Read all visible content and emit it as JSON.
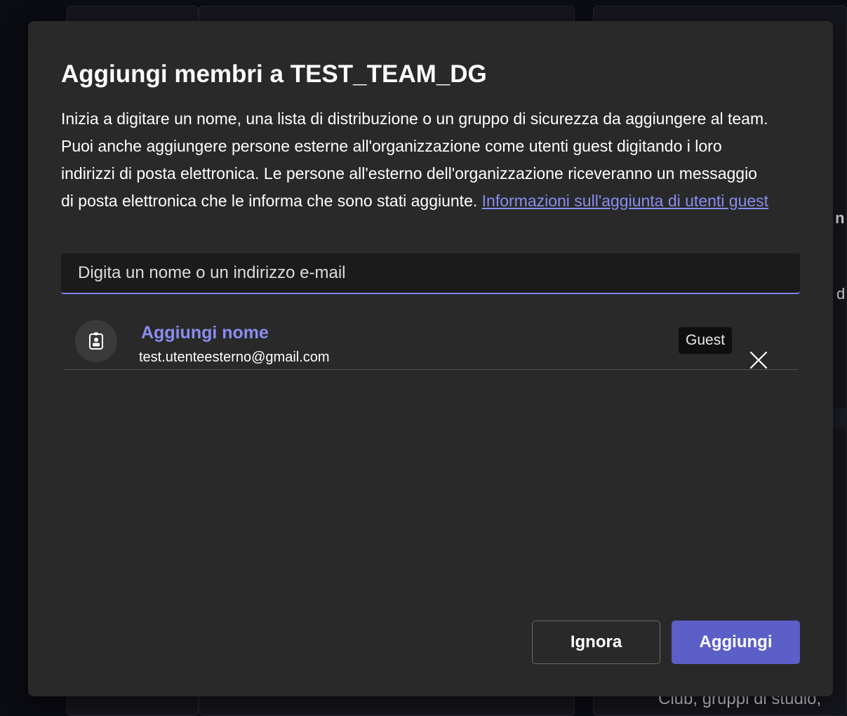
{
  "background": {
    "fragment_1": "n",
    "fragment_2": "d",
    "fragment_3": "Club, gruppi di studio,"
  },
  "dialog": {
    "title": "Aggiungi membri a TEST_TEAM_DG",
    "description": "Inizia a digitare un nome, una lista di distribuzione o un gruppo di sicurezza da aggiungere al team. Puoi anche aggiungere persone esterne all'organizzazione come utenti guest digitando i loro indirizzi di posta elettronica. Le persone all'esterno dell'organizzazione riceveranno un messaggio di posta elettronica che le informa che sono stati aggiunte.",
    "guest_link": "Informazioni sull'aggiunta di utenti guest",
    "search": {
      "placeholder": "Digita un nome o un indirizzo e-mail",
      "value": ""
    },
    "members": [
      {
        "name": "Aggiungi nome",
        "email": "test.utenteesterno@gmail.com",
        "badge": "Guest",
        "icon": "contact-card-icon"
      }
    ],
    "buttons": {
      "ignore": "Ignora",
      "add": "Aggiungi"
    }
  },
  "colors": {
    "accent": "#5b5fc7",
    "link": "#8b8cf0",
    "dialog_bg": "#292929"
  }
}
